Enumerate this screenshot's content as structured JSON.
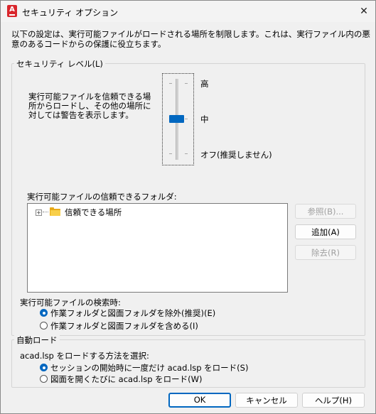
{
  "window": {
    "app_icon_letter": "A",
    "title": "セキュリティ オプション",
    "close_glyph": "✕"
  },
  "description": "以下の設定は、実行可能ファイルがロードされる場所を制限します。これは、実行ファイル内の悪意のあるコードからの保護に役立ちます。",
  "security_level": {
    "label": "セキュリティ レベル(L)",
    "text": "実行可能ファイルを信頼できる場所からロードし、その他の場所に対しては警告を表示します。",
    "levels": [
      "高",
      "中",
      "オフ(推奨しません)"
    ],
    "selected_index": 1
  },
  "trusted_folders": {
    "label": "実行可能ファイルの信頼できるフォルダ:",
    "tree_items": [
      {
        "expander": "+",
        "icon": "folder-icon",
        "label": "信頼できる場所"
      }
    ],
    "buttons": {
      "browse": "参照(B)...",
      "add": "追加(A)",
      "remove": "除去(R)"
    }
  },
  "search": {
    "label": "実行可能ファイルの検索時:",
    "options": [
      {
        "label": "作業フォルダと図面フォルダを除外(推奨)(E)",
        "selected": true
      },
      {
        "label": "作業フォルダと図面フォルダを含める(I)",
        "selected": false
      }
    ]
  },
  "autoload": {
    "label": "自動ロード",
    "prompt": "acad.lsp をロードする方法を選択:",
    "options": [
      {
        "label": "セッションの開始時に一度だけ acad.lsp をロード(S)",
        "selected": true
      },
      {
        "label": "図面を開くたびに acad.lsp をロード(W)",
        "selected": false
      }
    ]
  },
  "footer": {
    "ok": "OK",
    "cancel": "キャンセル",
    "help": "ヘルプ(H)"
  },
  "colors": {
    "accent": "#0067c0",
    "app_icon": "#d9262c",
    "folder": "#f8cf4a"
  }
}
